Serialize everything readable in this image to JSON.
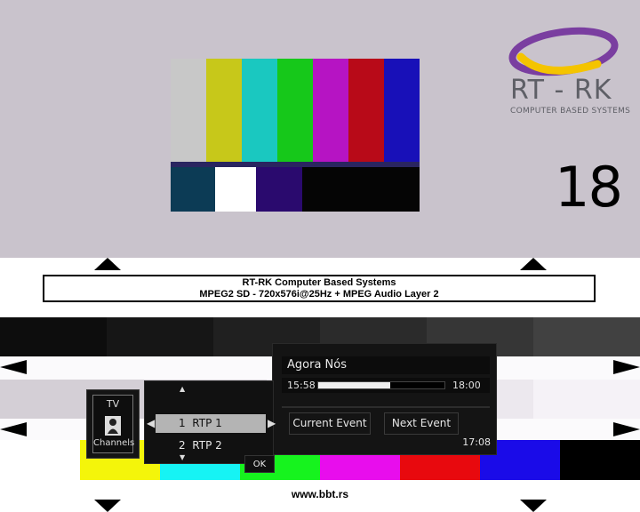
{
  "logo": {
    "name": "RT - RK",
    "subtitle": "COMPUTER BASED SYSTEMS"
  },
  "channel_number": "18",
  "info_box": {
    "line1": "RT-RK Computer Based Systems",
    "line2": "MPEG2 SD - 720x576i@25Hz + MPEG Audio Layer 2"
  },
  "footer": {
    "url": "www.bbt.rs"
  },
  "osd": {
    "event_title": "Agora Nós",
    "start_time": "15:58",
    "end_time": "18:00",
    "progress": 0.57,
    "current_event_label": "Current Event",
    "next_event_label": "Next Event",
    "clock": "17:08",
    "tv_label": "TV",
    "channels_label": "Channels",
    "channel_list": [
      {
        "number": "1",
        "name": "RTP 1",
        "selected": true
      },
      {
        "number": "2",
        "name": "RTP 2",
        "selected": false
      }
    ],
    "ok_label": "OK"
  },
  "colors": {
    "background_top": "#c9c3cc",
    "bar_yellow": "#f4f50a",
    "bar_cyan": "#16f3f4",
    "bar_green": "#16f31e",
    "bar_magenta": "#e80ded",
    "bar_red": "#e8090e",
    "bar_blue": "#1a0be8"
  }
}
